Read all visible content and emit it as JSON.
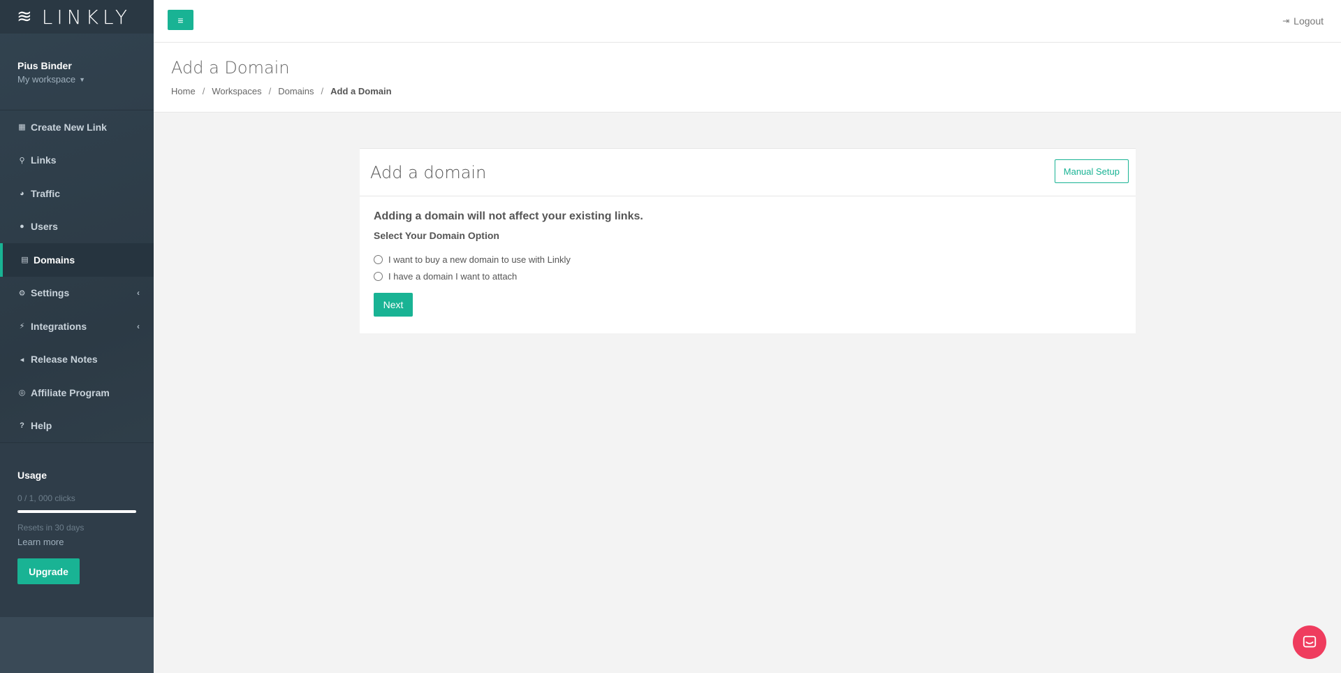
{
  "app": {
    "logo_icon": "≋",
    "logo_text": "LINKLY"
  },
  "user": {
    "name": "Pius Binder",
    "workspace": "My workspace"
  },
  "nav": [
    {
      "label": "Create New Link",
      "icon": "▦"
    },
    {
      "label": "Links",
      "icon": "⚲"
    },
    {
      "label": "Traffic",
      "icon": "◕"
    },
    {
      "label": "Users",
      "icon": "●"
    },
    {
      "label": "Domains",
      "icon": "▤",
      "active": true
    },
    {
      "label": "Settings",
      "icon": "⚙",
      "chevron": "‹"
    },
    {
      "label": "Integrations",
      "icon": "⚡",
      "chevron": "‹"
    },
    {
      "label": "Release Notes",
      "icon": "◂"
    },
    {
      "label": "Affiliate Program",
      "icon": "◎"
    },
    {
      "label": "Help",
      "icon": "?"
    }
  ],
  "usage": {
    "title": "Usage",
    "clicks": "0 / 1, 000 clicks",
    "progress_fraction": 0,
    "reset": "Resets in 30 days",
    "learn": "Learn more",
    "upgrade": "Upgrade"
  },
  "topbar": {
    "menu_icon": "≡",
    "logout": "Logout",
    "logout_icon": "⇥"
  },
  "page": {
    "title": "Add a Domain",
    "breadcrumb": [
      "Home",
      "Workspaces",
      "Domains",
      "Add a Domain"
    ],
    "breadcrumb_sep": "/"
  },
  "card": {
    "title": "Add a domain",
    "manual_setup": "Manual Setup",
    "notice": "Adding a domain will not affect your existing links.",
    "select_title": "Select Your Domain Option",
    "options": [
      "I want to buy a new domain to use with Linkly",
      "I have a domain I want to attach"
    ],
    "next": "Next"
  },
  "colors": {
    "accent": "#19b394",
    "chat": "#ef3c5e",
    "sidebar": "#2f3e4a"
  }
}
